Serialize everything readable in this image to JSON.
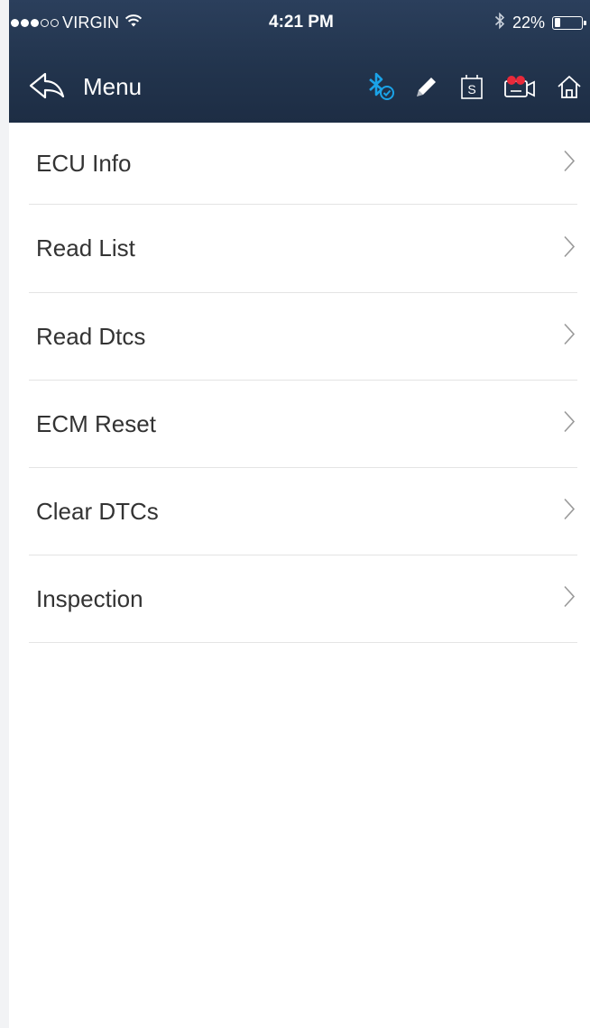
{
  "status_bar": {
    "carrier": "VIRGIN",
    "time": "4:21 PM",
    "battery": "22%",
    "battery_level": 0.22
  },
  "nav": {
    "back_label": "Menu",
    "icons": [
      "bluetooth-connected-icon",
      "pencil-icon",
      "screenshot-icon",
      "video-record-icon",
      "home-icon"
    ]
  },
  "menu": {
    "items": [
      {
        "label": "ECU Info"
      },
      {
        "label": "Read List"
      },
      {
        "label": "Read Dtcs"
      },
      {
        "label": "ECM Reset"
      },
      {
        "label": "Clear DTCs"
      },
      {
        "label": "Inspection"
      }
    ]
  },
  "colors": {
    "header_bg": "#22344d",
    "bluetooth_accent": "#1aa3e8",
    "record_accent": "#e8293a",
    "divider": "#e4e4e4",
    "item_text": "#333333"
  }
}
